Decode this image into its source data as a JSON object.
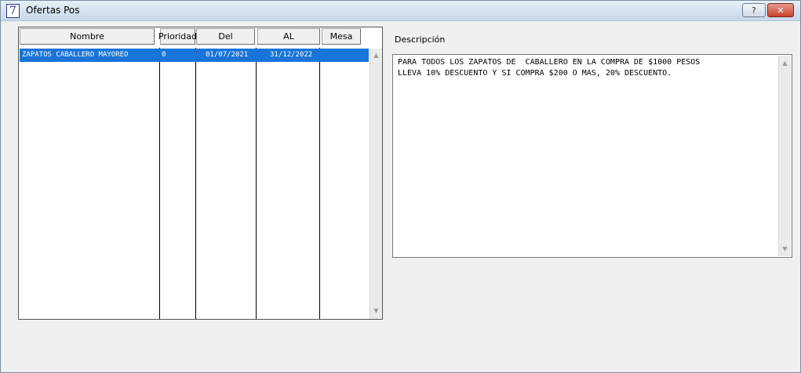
{
  "window": {
    "title": "Ofertas Pos",
    "icon_glyph": "7",
    "help_glyph": "?",
    "close_glyph": "✕"
  },
  "grid": {
    "columns": [
      "Nombre",
      "Prioridad",
      "Del",
      "AL",
      "Mesa"
    ],
    "rows": [
      {
        "nombre": "ZAPATOS CABALLERO MAYOREO",
        "prioridad": "0",
        "del": "01/07/2021",
        "al": "31/12/2022",
        "mesa": ""
      }
    ],
    "selected_row_color": "#1874d8"
  },
  "description": {
    "label": "Descripción",
    "text": "PARA TODOS LOS ZAPATOS DE  CABALLERO EN LA COMPRA DE $1000 PESOS\nLLEVA 10% DESCUENTO Y SI COMPRA $200 O MAS, 20% DESCUENTO."
  },
  "icons": {
    "scroll_up": "▲",
    "scroll_down": "▼"
  }
}
